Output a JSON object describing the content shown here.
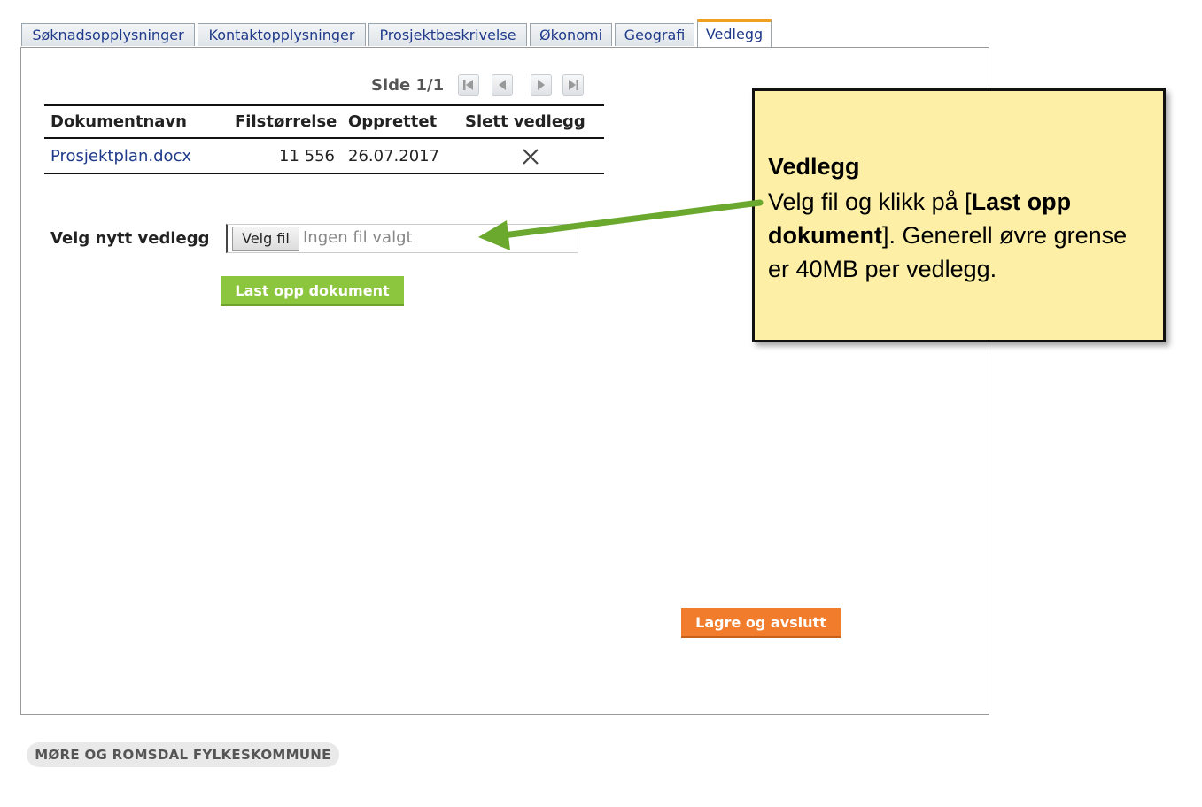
{
  "tabs": [
    {
      "label": "Søknadsopplysninger"
    },
    {
      "label": "Kontaktopplysninger"
    },
    {
      "label": "Prosjektbeskrivelse"
    },
    {
      "label": "Økonomi"
    },
    {
      "label": "Geografi"
    },
    {
      "label": "Vedlegg",
      "active": true
    }
  ],
  "pager": {
    "label": "Side 1/1"
  },
  "table": {
    "headers": [
      "Dokumentnavn",
      "Filstørrelse",
      "Opprettet",
      "Slett vedlegg"
    ],
    "rows": [
      {
        "name": "Prosjektplan.docx",
        "size": "11 556",
        "created": "26.07.2017"
      }
    ]
  },
  "upload": {
    "label": "Velg nytt vedlegg",
    "choose_button": "Velg fil",
    "no_file": "Ingen fil valgt",
    "upload_button": "Last opp dokument"
  },
  "save_button": "Lagre og avslutt",
  "callout": {
    "title": "Vedlegg",
    "body_prefix": "Velg fil og klikk på [",
    "body_bold": "Last opp dokument",
    "body_suffix": "]. Generell øvre grense er 40MB per vedlegg."
  },
  "footer": {
    "label": "MØRE OG ROMSDAL FYLKESKOMMUNE"
  },
  "colors": {
    "callout_bg": "#fdf0a6",
    "arrow": "#6aa82e",
    "upload_btn": "#8cc63f",
    "save_btn": "#f07c2c",
    "tab_active": "#f0a020"
  }
}
